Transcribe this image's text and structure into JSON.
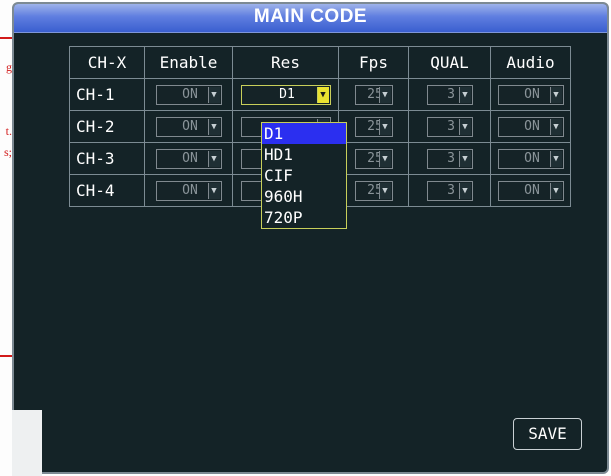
{
  "window": {
    "title": "MAIN CODE"
  },
  "columns": [
    "CH-X",
    "Enable",
    "Res",
    "Fps",
    "QUAL",
    "Audio"
  ],
  "rows": [
    {
      "ch": "CH-1",
      "enable": "ON",
      "res": "D1",
      "fps": "25",
      "qual": "3",
      "audio": "ON"
    },
    {
      "ch": "CH-2",
      "enable": "ON",
      "res": "",
      "fps": "25",
      "qual": "3",
      "audio": "ON"
    },
    {
      "ch": "CH-3",
      "enable": "ON",
      "res": "",
      "fps": "25",
      "qual": "3",
      "audio": "ON"
    },
    {
      "ch": "CH-4",
      "enable": "ON",
      "res": "",
      "fps": "25",
      "qual": "3",
      "audio": "ON"
    }
  ],
  "res_dropdown": {
    "options": [
      "D1",
      "HD1",
      "CIF",
      "960H",
      "720P"
    ],
    "selected": "D1"
  },
  "annotations": [
    "g",
    "t.",
    "s;"
  ],
  "buttons": {
    "save": "SAVE"
  },
  "colors": {
    "background": "#142327",
    "title_bar": "#4f73da",
    "dropdown_selected": "#2b2ff0",
    "annotation_red": "#d21b1b"
  }
}
